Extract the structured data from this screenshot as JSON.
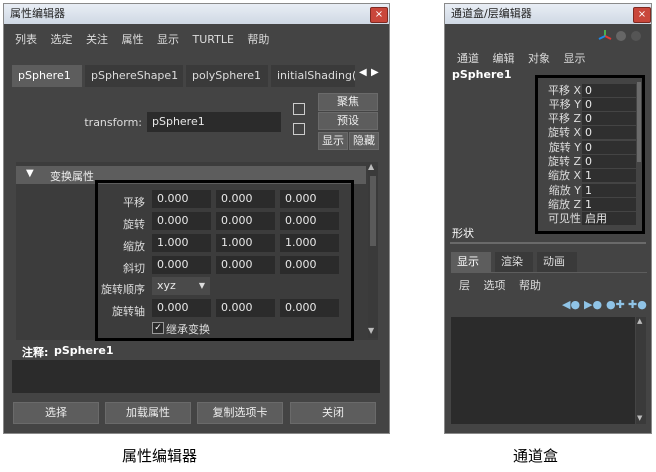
{
  "attr_editor": {
    "title": "属性编辑器",
    "close": "×",
    "menu": [
      "列表",
      "选定",
      "关注",
      "属性",
      "显示",
      "TURTLE",
      "帮助"
    ],
    "tabs": [
      "pSphere1",
      "pSphereShape1",
      "polySphere1",
      "initialShading("
    ],
    "transform_label": "transform:",
    "transform_value": "pSphere1",
    "focus_btn": "聚焦",
    "preset_btn": "预设",
    "show_btn": "显示",
    "hide_btn": "隐藏",
    "section_title": "变换属性",
    "rows": [
      {
        "label": "平移",
        "v": [
          "0.000",
          "0.000",
          "0.000"
        ]
      },
      {
        "label": "旋转",
        "v": [
          "0.000",
          "0.000",
          "0.000"
        ]
      },
      {
        "label": "缩放",
        "v": [
          "1.000",
          "1.000",
          "1.000"
        ]
      },
      {
        "label": "斜切",
        "v": [
          "0.000",
          "0.000",
          "0.000"
        ]
      }
    ],
    "rotate_order_label": "旋转顺序",
    "rotate_order_value": "xyz",
    "rotate_axis_label": "旋转轴",
    "rotate_axis": [
      "0.000",
      "0.000",
      "0.000"
    ],
    "inherit_check": "继承变换",
    "notes_label": "注释:",
    "notes_value": "pSphere1",
    "bottom_buttons": [
      "选择",
      "加载属性",
      "复制选项卡",
      "关闭"
    ],
    "caption": "属性编辑器"
  },
  "channel_box": {
    "title": "通道盒/层编辑器",
    "close": "×",
    "menu": [
      "通道",
      "编辑",
      "对象",
      "显示"
    ],
    "object_name": "pSphere1",
    "channels": [
      {
        "label": "平移 X",
        "value": "0"
      },
      {
        "label": "平移 Y",
        "value": "0"
      },
      {
        "label": "平移 Z",
        "value": "0"
      },
      {
        "label": "旋转 X",
        "value": "0"
      },
      {
        "label": "旋转 Y",
        "value": "0"
      },
      {
        "label": "旋转 Z",
        "value": "0"
      },
      {
        "label": "缩放 X",
        "value": "1"
      },
      {
        "label": "缩放 Y",
        "value": "1"
      },
      {
        "label": "缩放 Z",
        "value": "1"
      },
      {
        "label": "可见性",
        "value": "启用"
      }
    ],
    "shape_label": "形状",
    "layer_tabs": [
      "显示",
      "渲染",
      "动画"
    ],
    "layer_menu": [
      "层",
      "选项",
      "帮助"
    ],
    "caption": "通道盒"
  }
}
